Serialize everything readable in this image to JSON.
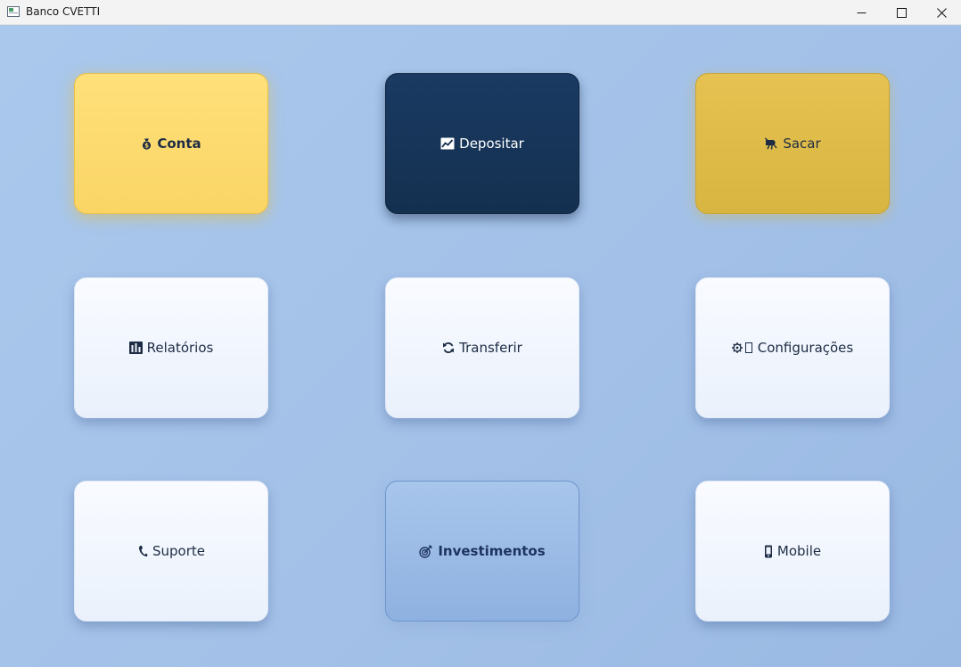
{
  "window": {
    "title": "Banco CVETTI"
  },
  "tiles": [
    {
      "label": "Conta",
      "icon": "money-bag-icon"
    },
    {
      "label": "Depositar",
      "icon": "chart-increasing-icon"
    },
    {
      "label": "Sacar",
      "icon": "money-with-wings-icon"
    },
    {
      "label": "Relatórios",
      "icon": "bar-chart-icon"
    },
    {
      "label": "Transferir",
      "icon": "refresh-arrows-icon"
    },
    {
      "label": "Configurações",
      "icon": "gear-icon"
    },
    {
      "label": "Suporte",
      "icon": "phone-icon"
    },
    {
      "label": "Investimentos",
      "icon": "target-icon"
    },
    {
      "label": "Mobile",
      "icon": "mobile-phone-icon"
    }
  ],
  "colors": {
    "background": "#a9c6ea",
    "gold": "#fad565",
    "navy": "#14304f",
    "dark_gold": "#d8b540",
    "white_tile": "#f5f8fd",
    "accent_blue": "#8fb1e0"
  }
}
